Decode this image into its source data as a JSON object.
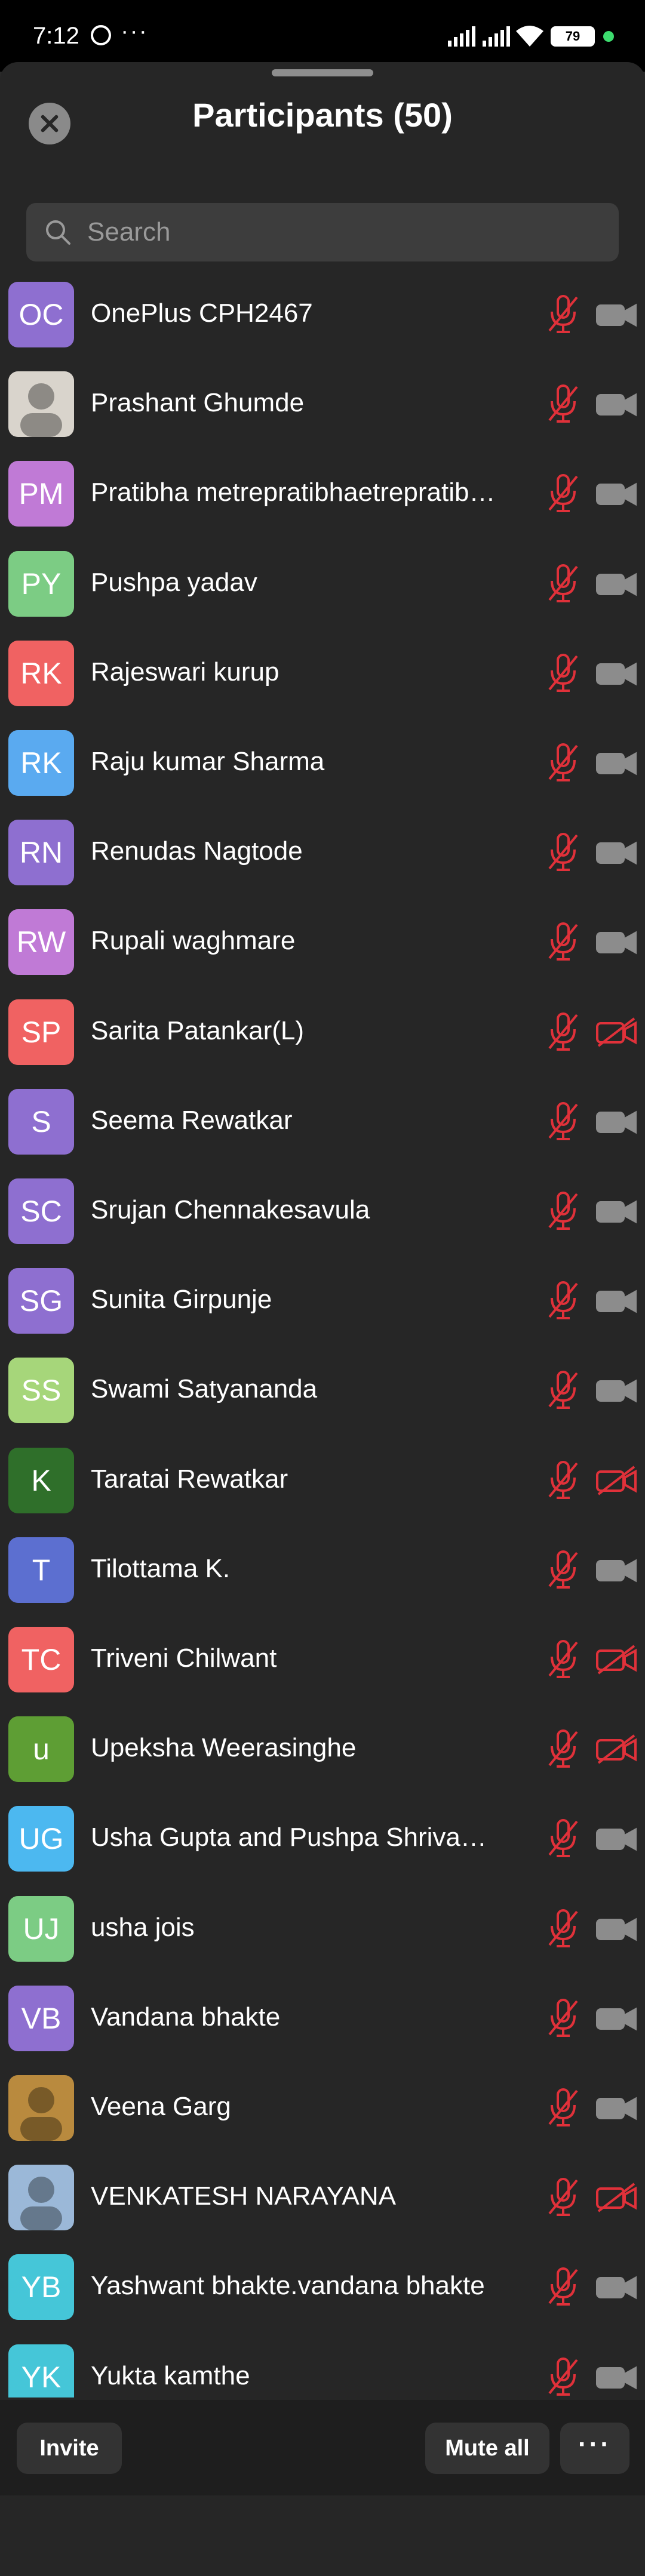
{
  "status_bar": {
    "time": "7:12",
    "battery": "79"
  },
  "header": {
    "title": "Participants (50)"
  },
  "search": {
    "placeholder": "Search"
  },
  "participants": [
    {
      "initials": "OC",
      "name": "OnePlus CPH2467",
      "avatar_color": "#8e6fd0",
      "mic_muted": true,
      "video_off": false
    },
    {
      "initials": "",
      "name": "Prashant Ghumde",
      "avatar_color": "#d9d4cc",
      "photo": true,
      "mic_muted": true,
      "video_off": false
    },
    {
      "initials": "PM",
      "name": "Pratibha metrepratibhaetrepratib…",
      "avatar_color": "#c07ad6",
      "mic_muted": true,
      "video_off": false
    },
    {
      "initials": "PY",
      "name": "Pushpa yadav",
      "avatar_color": "#7ccc84",
      "mic_muted": true,
      "video_off": false
    },
    {
      "initials": "RK",
      "name": "Rajeswari kurup",
      "avatar_color": "#f06262",
      "mic_muted": true,
      "video_off": false
    },
    {
      "initials": "RK",
      "name": "Raju kumar Sharma",
      "avatar_color": "#5aaaf0",
      "mic_muted": true,
      "video_off": false
    },
    {
      "initials": "RN",
      "name": "Renudas Nagtode",
      "avatar_color": "#8e6fd0",
      "mic_muted": true,
      "video_off": false
    },
    {
      "initials": "RW",
      "name": "Rupali waghmare",
      "avatar_color": "#c07ad6",
      "mic_muted": true,
      "video_off": false
    },
    {
      "initials": "SP",
      "name": "Sarita Patankar(L)",
      "avatar_color": "#f06262",
      "mic_muted": true,
      "video_off": true
    },
    {
      "initials": "S",
      "name": "Seema  Rewatkar",
      "avatar_color": "#8e6fd0",
      "mic_muted": true,
      "video_off": false
    },
    {
      "initials": "SC",
      "name": "Srujan Chennakesavula",
      "avatar_color": "#8e6fd0",
      "mic_muted": true,
      "video_off": false
    },
    {
      "initials": "SG",
      "name": "Sunita Girpunje",
      "avatar_color": "#8e6fd0",
      "mic_muted": true,
      "video_off": false
    },
    {
      "initials": "SS",
      "name": "Swami Satyananda",
      "avatar_color": "#a6d67a",
      "mic_muted": true,
      "video_off": false
    },
    {
      "initials": "K",
      "name": "Taratai Rewatkar",
      "avatar_color": "#2f6f2a",
      "mic_muted": true,
      "video_off": true
    },
    {
      "initials": "T",
      "name": "Tilottama K.",
      "avatar_color": "#5c6fd0",
      "mic_muted": true,
      "video_off": false
    },
    {
      "initials": "TC",
      "name": "Triveni Chilwant",
      "avatar_color": "#f06262",
      "mic_muted": true,
      "video_off": true
    },
    {
      "initials": "u",
      "name": "Upeksha Weerasinghe",
      "avatar_color": "#5e9e34",
      "mic_muted": true,
      "video_off": true
    },
    {
      "initials": "UG",
      "name": "Usha Gupta and Pushpa Shrivast…",
      "avatar_color": "#4cb8f0",
      "mic_muted": true,
      "video_off": false
    },
    {
      "initials": "UJ",
      "name": "usha jois",
      "avatar_color": "#7ccc84",
      "mic_muted": true,
      "video_off": false
    },
    {
      "initials": "VB",
      "name": "Vandana bhakte",
      "avatar_color": "#8e6fd0",
      "mic_muted": true,
      "video_off": false
    },
    {
      "initials": "",
      "name": "Veena Garg",
      "avatar_color": "#b98a3e",
      "photo": true,
      "mic_muted": true,
      "video_off": false
    },
    {
      "initials": "",
      "name": "VENKATESH NARAYANA",
      "avatar_color": "#9bb8d8",
      "photo": true,
      "mic_muted": true,
      "video_off": true
    },
    {
      "initials": "YB",
      "name": "Yashwant bhakte.vandana bhakte",
      "avatar_color": "#45c6d8",
      "mic_muted": true,
      "video_off": false
    },
    {
      "initials": "YK",
      "name": "Yukta kamthe",
      "avatar_color": "#45c6d8",
      "mic_muted": true,
      "video_off": false
    }
  ],
  "footer": {
    "invite_label": "Invite",
    "mute_all_label": "Mute all",
    "more_label": "···"
  },
  "colors": {
    "muted_red": "#e0313a",
    "camera_gray": "#8c8c8c",
    "sheet_bg": "#262626"
  }
}
